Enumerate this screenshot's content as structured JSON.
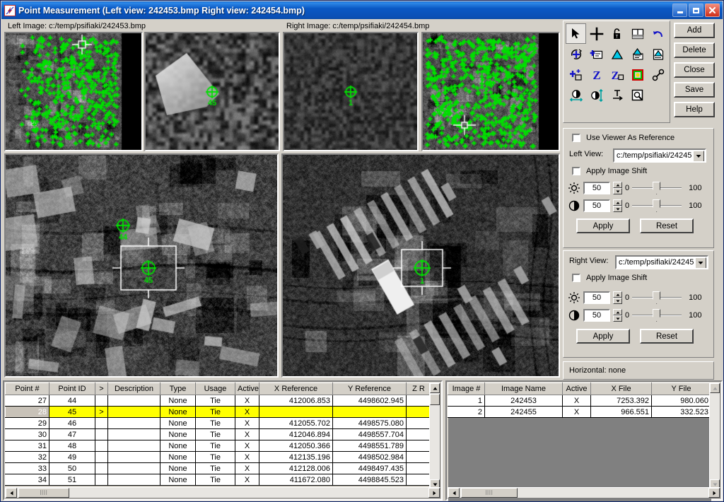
{
  "window": {
    "title": "Point Measurement (Left view: 242453.bmp  Right view: 242454.bmp)",
    "icon": "app-icon",
    "minimize": "_",
    "maximize": "□",
    "close": "✕"
  },
  "image_labels": {
    "left": "Left Image: c:/temp/psifiaki/242453.bmp",
    "right": "Right Image: c:/temp/psifiaki/242454.bmp"
  },
  "views": {
    "left_overview": {
      "name": "left-overview-image",
      "point_count_label": ""
    },
    "left_detail": {
      "name": "left-detail-image",
      "point_label": "45"
    },
    "right_detail": {
      "name": "right-detail-image",
      "point_label": "1"
    },
    "right_overview": {
      "name": "right-overview-image"
    },
    "left_main": {
      "name": "left-main-image",
      "labels": [
        "44",
        "45"
      ]
    },
    "right_main": {
      "name": "right-main-image",
      "labels": [
        "1"
      ]
    }
  },
  "toolbar": {
    "tools": [
      {
        "id": "select-arrow",
        "title": "Select",
        "selected": true
      },
      {
        "id": "crosshair",
        "title": "Create Point",
        "selected": false
      },
      {
        "id": "lock",
        "title": "Lock",
        "selected": false
      },
      {
        "id": "split-view",
        "title": "Split View",
        "selected": false
      },
      {
        "id": "undo-arrow",
        "title": "Undo",
        "selected": false
      },
      {
        "id": "auto-locate",
        "title": "Auto Locate",
        "selected": false
      },
      {
        "id": "add-to-list",
        "title": "Add To List",
        "selected": false
      },
      {
        "id": "triangle",
        "title": "Triangulate",
        "selected": false
      },
      {
        "id": "triangle-list",
        "title": "Triangulate List",
        "selected": false
      },
      {
        "id": "triangle-report",
        "title": "Triangulate Report",
        "selected": false
      },
      {
        "id": "add-point",
        "title": "Add Point",
        "selected": false
      },
      {
        "id": "z-value",
        "title": "Z",
        "selected": false
      },
      {
        "id": "z-box",
        "title": "Z Box",
        "selected": false
      },
      {
        "id": "color-swatch",
        "title": "Color",
        "selected": false
      },
      {
        "id": "link-chain",
        "title": "Link",
        "selected": false
      },
      {
        "id": "horizontal-drive",
        "title": "Horizontal Drive",
        "selected": false
      },
      {
        "id": "vertical-drive",
        "title": "Vertical Drive",
        "selected": false
      },
      {
        "id": "advance-mode",
        "title": "Advance",
        "selected": false
      },
      {
        "id": "zoom-window",
        "title": "Zoom Window",
        "selected": false
      }
    ],
    "buttons": [
      {
        "id": "add-button",
        "label": "Add"
      },
      {
        "id": "delete-button",
        "label": "Delete"
      },
      {
        "id": "close-button",
        "label": "Close"
      },
      {
        "id": "save-button",
        "label": "Save"
      },
      {
        "id": "help-button",
        "label": "Help"
      }
    ]
  },
  "reference": {
    "use_viewer_as_reference": "Use Viewer As Reference",
    "use_viewer_checked": false
  },
  "left_view_panel": {
    "view_label": "Left View:",
    "view_value": "c:/temp/psifiaki/24245",
    "apply_shift_label": "Apply Image Shift",
    "apply_shift_checked": false,
    "brightness": {
      "icon": "sun-icon",
      "value": "50",
      "min": "0",
      "max": "100"
    },
    "contrast": {
      "icon": "contrast-icon",
      "value": "50",
      "min": "0",
      "max": "100"
    },
    "apply_label": "Apply",
    "reset_label": "Reset"
  },
  "right_view_panel": {
    "view_label": "Right View:",
    "view_value": "c:/temp/psifiaki/24245",
    "apply_shift_label": "Apply Image Shift",
    "apply_shift_checked": false,
    "brightness": {
      "icon": "sun-icon",
      "value": "50",
      "min": "0",
      "max": "100"
    },
    "contrast": {
      "icon": "contrast-icon",
      "value": "50",
      "min": "0",
      "max": "100"
    },
    "apply_label": "Apply",
    "reset_label": "Reset"
  },
  "status": {
    "horizontal": "Horizontal: none"
  },
  "points_table": {
    "columns": [
      "Point #",
      "Point ID",
      ">",
      "Description",
      "Type",
      "Usage",
      "Active",
      "X Reference",
      "Y Reference",
      "Z R"
    ],
    "rows": [
      {
        "num": "27",
        "id": "44",
        "gt": "",
        "desc": "",
        "type": "None",
        "usage": "Tie",
        "active": "X",
        "xref": "412006.853",
        "yref": "4498602.945",
        "zref": "",
        "highlight": false,
        "selected": false
      },
      {
        "num": "28",
        "id": "45",
        "gt": ">",
        "desc": "",
        "type": "None",
        "usage": "Tie",
        "active": "X",
        "xref": "",
        "yref": "",
        "zref": "",
        "highlight": true,
        "selected": true
      },
      {
        "num": "29",
        "id": "46",
        "gt": "",
        "desc": "",
        "type": "None",
        "usage": "Tie",
        "active": "X",
        "xref": "412055.702",
        "yref": "4498575.080",
        "zref": "",
        "highlight": false,
        "selected": false
      },
      {
        "num": "30",
        "id": "47",
        "gt": "",
        "desc": "",
        "type": "None",
        "usage": "Tie",
        "active": "X",
        "xref": "412046.894",
        "yref": "4498557.704",
        "zref": "",
        "highlight": false,
        "selected": false
      },
      {
        "num": "31",
        "id": "48",
        "gt": "",
        "desc": "",
        "type": "None",
        "usage": "Tie",
        "active": "X",
        "xref": "412050.366",
        "yref": "4498551.789",
        "zref": "",
        "highlight": false,
        "selected": false
      },
      {
        "num": "32",
        "id": "49",
        "gt": "",
        "desc": "",
        "type": "None",
        "usage": "Tie",
        "active": "X",
        "xref": "412135.196",
        "yref": "4498502.984",
        "zref": "",
        "highlight": false,
        "selected": false
      },
      {
        "num": "33",
        "id": "50",
        "gt": "",
        "desc": "",
        "type": "None",
        "usage": "Tie",
        "active": "X",
        "xref": "412128.006",
        "yref": "4498497.435",
        "zref": "",
        "highlight": false,
        "selected": false
      },
      {
        "num": "34",
        "id": "51",
        "gt": "",
        "desc": "",
        "type": "None",
        "usage": "Tie",
        "active": "X",
        "xref": "411672.080",
        "yref": "4498845.523",
        "zref": "",
        "highlight": false,
        "selected": false
      }
    ]
  },
  "images_table": {
    "columns": [
      "Image #",
      "Image Name",
      "Active",
      "X File",
      "Y File"
    ],
    "rows": [
      {
        "num": "1",
        "name": "242453",
        "active": "X",
        "xfile": "7253.392",
        "yfile": "980.060"
      },
      {
        "num": "2",
        "name": "242455",
        "active": "X",
        "xfile": "966.551",
        "yfile": "332.523"
      }
    ]
  },
  "colors": {
    "titlebar": "#0a58c4",
    "face": "#d4d0c8",
    "highlight_row": "#ffff00",
    "marker_green": "#00dd00",
    "close_red": "#cf2f1a"
  }
}
